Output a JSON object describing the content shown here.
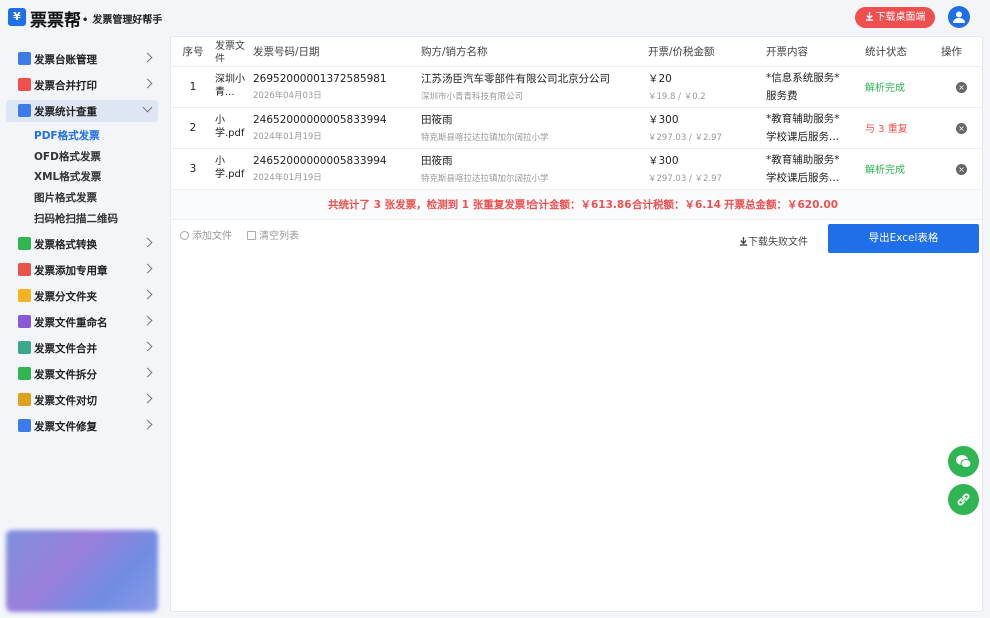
{
  "app": {
    "logo_glyph": "¥",
    "name": "票票帮",
    "slogan": "发票管理好帮手",
    "download_label": "下载桌面端"
  },
  "sidebar": {
    "items": [
      {
        "label": "发票台账管理",
        "icon": "ledger-icon",
        "color": "#3b7ce8"
      },
      {
        "label": "发票合并打印",
        "icon": "printer-icon",
        "color": "#f04f4f"
      },
      {
        "label": "发票统计查重",
        "icon": "stats-icon",
        "color": "#3b7ce8",
        "active": true
      },
      {
        "label": "发票格式转换",
        "icon": "convert-icon",
        "color": "#2fb552"
      },
      {
        "label": "发票添加专用章",
        "icon": "stamp-icon",
        "color": "#e8544c"
      },
      {
        "label": "发票分文件夹",
        "icon": "folder-icon",
        "color": "#f5b324"
      },
      {
        "label": "发票文件重命名",
        "icon": "rename-icon",
        "color": "#8a5ad6"
      },
      {
        "label": "发票文件合并",
        "icon": "merge-icon",
        "color": "#3aa88a"
      },
      {
        "label": "发票文件拆分",
        "icon": "split-icon",
        "color": "#2fb552"
      },
      {
        "label": "发票文件对切",
        "icon": "cut-icon",
        "color": "#e0a020"
      },
      {
        "label": "发票文件修复",
        "icon": "wrench-icon",
        "color": "#3b7ce8"
      }
    ],
    "sub_items": [
      {
        "label": "PDF格式发票",
        "selected": true
      },
      {
        "label": "OFD格式发票"
      },
      {
        "label": "XML格式发票"
      },
      {
        "label": "图片格式发票"
      },
      {
        "label": "扫码枪扫描二维码"
      }
    ]
  },
  "table": {
    "headers": {
      "index": "序号",
      "file": "发票文件",
      "number": "发票号码/日期",
      "party": "购方/销方名称",
      "amount": "开票/价税金额",
      "content": "开票内容",
      "status": "统计状态",
      "action": "操作"
    },
    "rows": [
      {
        "index": "1",
        "file": "深圳小青...",
        "number": "26952000001372585981",
        "date": "2026年04月03日",
        "buyer": "江苏汤臣汽车零部件有限公司北京分公司",
        "seller": "深圳市小青青科技有限公司",
        "amount": "￥20",
        "amount_detail": "￥19.8 / ￥0.2",
        "content_1": "*信息系统服务*",
        "content_2": "服务费",
        "status": "解析完成",
        "status_type": "ok"
      },
      {
        "index": "2",
        "file": "小学.pdf",
        "number": "24652000000005833994",
        "date": "2024年01月19日",
        "buyer": "田筱雨",
        "seller": "特克斯县喀拉达拉镇加尔阔拉小学",
        "amount": "￥300",
        "amount_detail": "￥297.03 / ￥2.97",
        "content_1": "*教育辅助服务*",
        "content_2": "学校课后服务...",
        "status": "与 3 重复",
        "status_type": "dup"
      },
      {
        "index": "3",
        "file": "小学.pdf",
        "number": "24652000000005833994",
        "date": "2024年01月19日",
        "buyer": "田筱雨",
        "seller": "特克斯县喀拉达拉镇加尔阔拉小学",
        "amount": "￥300",
        "amount_detail": "￥297.03 / ￥2.97",
        "content_1": "*教育辅助服务*",
        "content_2": "学校课后服务...",
        "status": "解析完成",
        "status_type": "ok"
      }
    ]
  },
  "summary": {
    "count_text": "共统计了 3 张发票，检测到 1 张重复发票！",
    "total_amount": "合计金额：￥613.86",
    "total_tax": "合计税额：￥6.14",
    "grand_total": "开票总金额：￥620.00"
  },
  "toolbar": {
    "add_file": "添加文件",
    "clear_list": "清空列表",
    "download_failed": "下载失败文件",
    "export_excel": "导出Excel表格"
  },
  "colors": {
    "accent": "#1e6fe8",
    "danger": "#f04f4f",
    "success": "#2fb552"
  }
}
